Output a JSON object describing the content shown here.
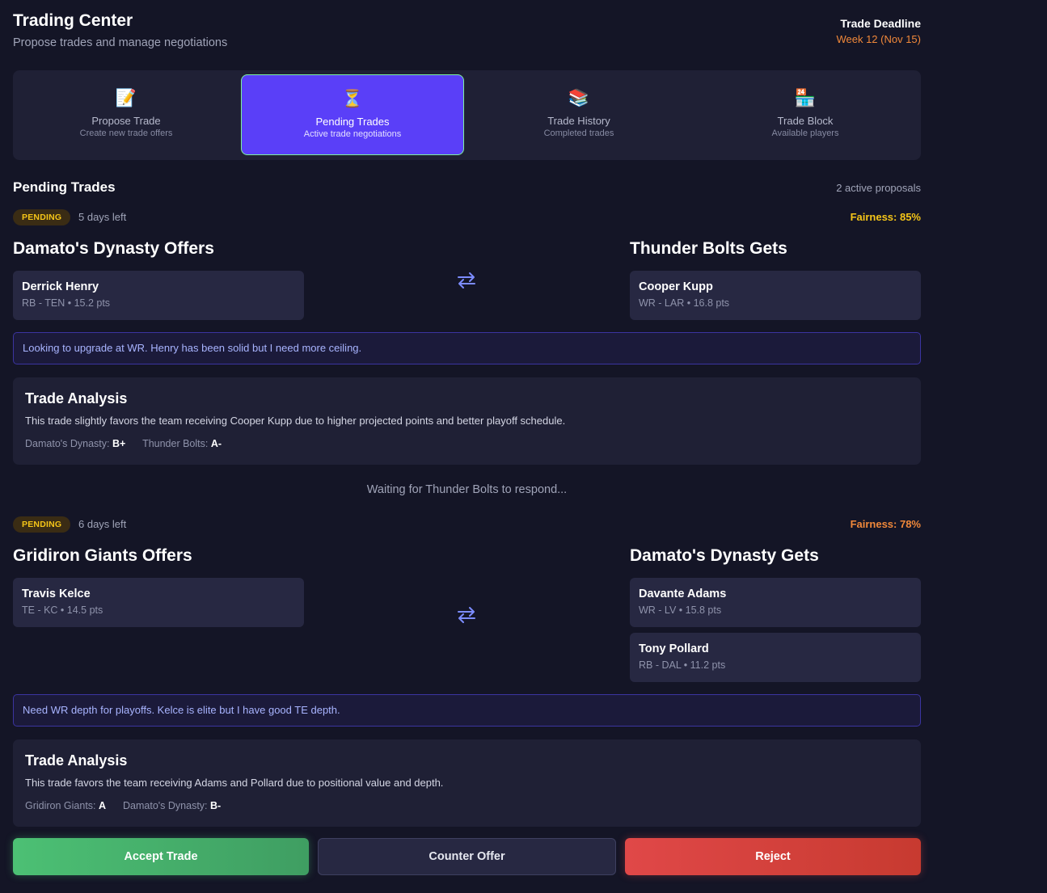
{
  "header": {
    "title": "Trading Center",
    "subtitle": "Propose trades and manage negotiations",
    "deadline_label": "Trade Deadline",
    "deadline_value": "Week 12 (Nov 15)"
  },
  "tabs": [
    {
      "label": "Propose Trade",
      "sub": "Create new trade offers",
      "icon": "memo-icon",
      "glyph": "📝",
      "active": false
    },
    {
      "label": "Pending Trades",
      "sub": "Active trade negotiations",
      "icon": "hourglass-icon",
      "glyph": "⏳",
      "active": true
    },
    {
      "label": "Trade History",
      "sub": "Completed trades",
      "icon": "books-icon",
      "glyph": "📚",
      "active": false
    },
    {
      "label": "Trade Block",
      "sub": "Available players",
      "icon": "store-icon",
      "glyph": "🏪",
      "active": false
    }
  ],
  "section": {
    "title": "Pending Trades",
    "count": "2 active proposals"
  },
  "trades": [
    {
      "status": "PENDING",
      "days_left": "5 days left",
      "fairness": "Fairness: 85%",
      "fairness_color": "#f5c518",
      "offer_team": "Damato's Dynasty Offers",
      "get_team": "Thunder Bolts Gets",
      "offers": [
        {
          "name": "Derrick Henry",
          "meta": "RB - TEN • 15.2 pts"
        }
      ],
      "gets": [
        {
          "name": "Cooper Kupp",
          "meta": "WR - LAR • 16.8 pts"
        }
      ],
      "message": "Looking to upgrade at WR. Henry has been solid but I need more ceiling.",
      "analysis_title": "Trade Analysis",
      "analysis_text": "This trade slightly favors the team receiving Cooper Kupp due to higher projected points and better playoff schedule.",
      "grades": [
        {
          "team": "Damato's Dynasty:",
          "grade": "B+"
        },
        {
          "team": "Thunder Bolts:",
          "grade": "A-"
        }
      ],
      "waiting": "Waiting for Thunder Bolts to respond..."
    },
    {
      "status": "PENDING",
      "days_left": "6 days left",
      "fairness": "Fairness: 78%",
      "fairness_color": "#f0883a",
      "offer_team": "Gridiron Giants Offers",
      "get_team": "Damato's Dynasty Gets",
      "offers": [
        {
          "name": "Travis Kelce",
          "meta": "TE - KC • 14.5 pts"
        }
      ],
      "gets": [
        {
          "name": "Davante Adams",
          "meta": "WR - LV • 15.8 pts"
        },
        {
          "name": "Tony Pollard",
          "meta": "RB - DAL • 11.2 pts"
        }
      ],
      "message": "Need WR depth for playoffs. Kelce is elite but I have good TE depth.",
      "analysis_title": "Trade Analysis",
      "analysis_text": "This trade favors the team receiving Adams and Pollard due to positional value and depth.",
      "grades": [
        {
          "team": "Gridiron Giants:",
          "grade": "A"
        },
        {
          "team": "Damato's Dynasty:",
          "grade": "B-"
        }
      ]
    }
  ],
  "actions": {
    "accept": "Accept Trade",
    "counter": "Counter Offer",
    "reject": "Reject"
  },
  "colors": {
    "accent": "#5a3ff8",
    "deadline": "#f0883a",
    "accept": "#4cc074",
    "reject": "#e04848"
  }
}
